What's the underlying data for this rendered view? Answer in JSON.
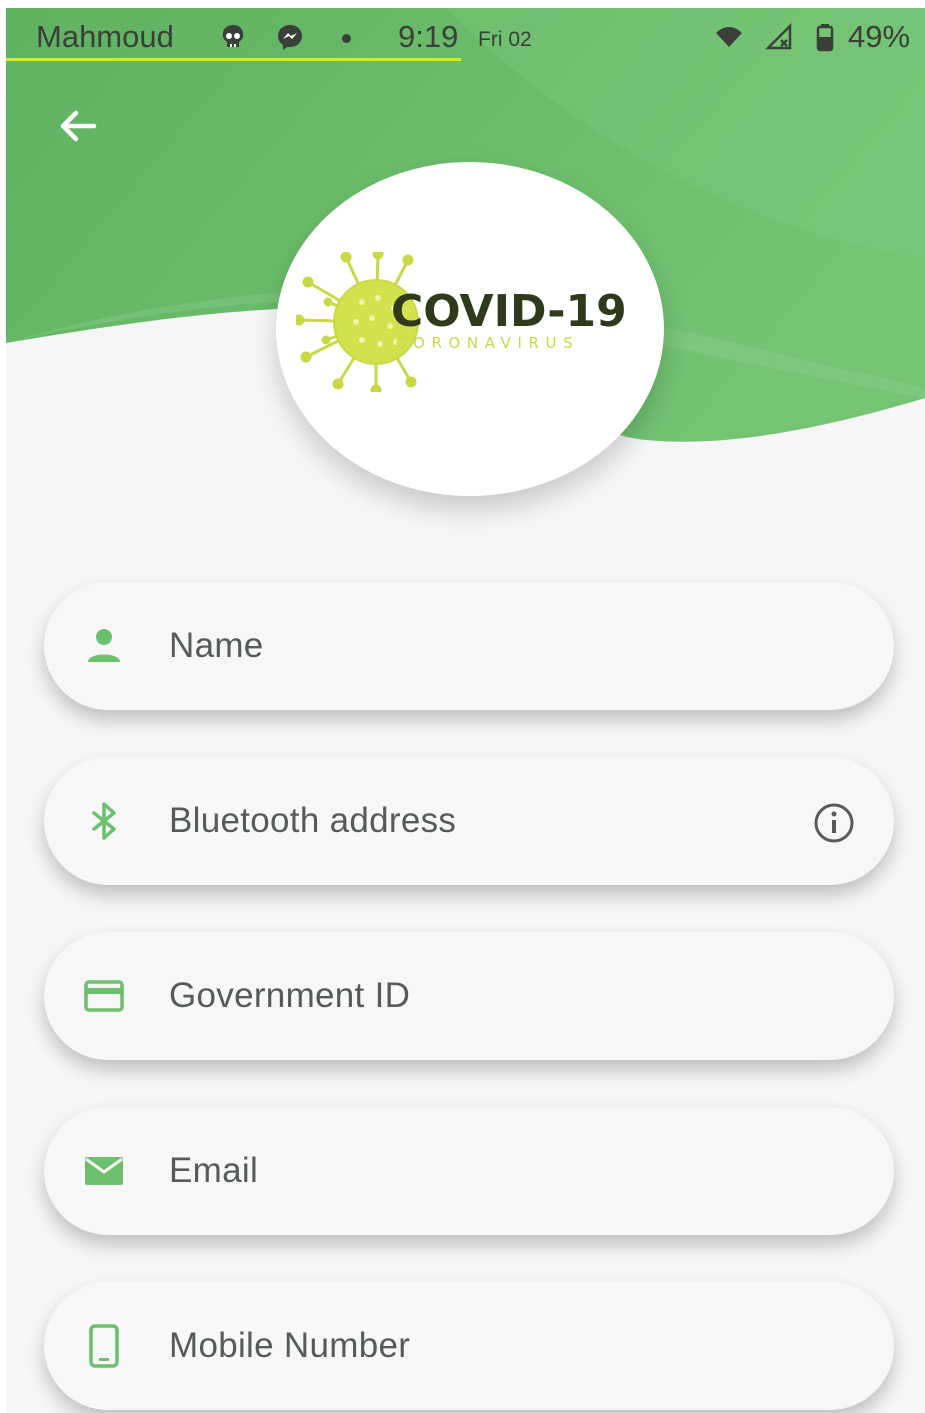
{
  "status_bar": {
    "carrier": "Mahmoud",
    "time": "9:19",
    "date": "Fri 02",
    "battery": "49%",
    "icons": [
      "skull-icon",
      "messenger-icon",
      "wifi-icon",
      "signal-icon",
      "battery-icon"
    ]
  },
  "header": {
    "back_icon": "arrow-left-icon",
    "accent_color": "#6fbf6f"
  },
  "logo": {
    "title": "COVID-19",
    "subtitle": "CORONAVIRUS",
    "virus_color": "#c9d845"
  },
  "form": {
    "fields": [
      {
        "placeholder": "Name",
        "icon": "person-icon"
      },
      {
        "placeholder": "Bluetooth address",
        "icon": "bluetooth-icon",
        "trailing_icon": "info-icon"
      },
      {
        "placeholder": "Government ID",
        "icon": "id-card-icon"
      },
      {
        "placeholder": "Email",
        "icon": "mail-icon"
      },
      {
        "placeholder": "Mobile Number",
        "icon": "phone-icon"
      }
    ],
    "icon_color": "#6cbf6c"
  }
}
